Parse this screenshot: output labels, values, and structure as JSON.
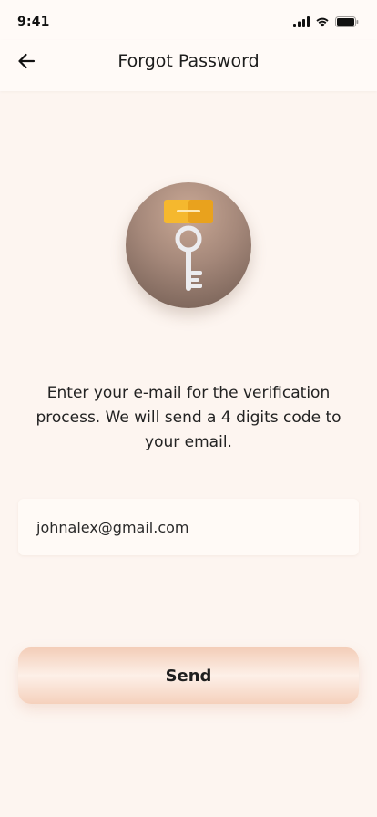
{
  "status_bar": {
    "time": "9:41",
    "icons": [
      "signal-icon",
      "wifi-icon",
      "battery-icon"
    ]
  },
  "header": {
    "back_icon": "arrow-left-icon",
    "title": "Forgot Password"
  },
  "illustration": {
    "icon": "key-icon",
    "colors": {
      "circle": "#a5887a",
      "tag": "#f5b82e",
      "key": "#e8e8ea"
    }
  },
  "instructions": {
    "text": "Enter your e-mail for the verification process. We will send a 4 digits code to your email."
  },
  "email": {
    "value": "johnalex@gmail.com"
  },
  "send_button": {
    "label": "Send"
  },
  "colors": {
    "background": "#fdf5f0",
    "button_accent": "#f3cdb8"
  }
}
